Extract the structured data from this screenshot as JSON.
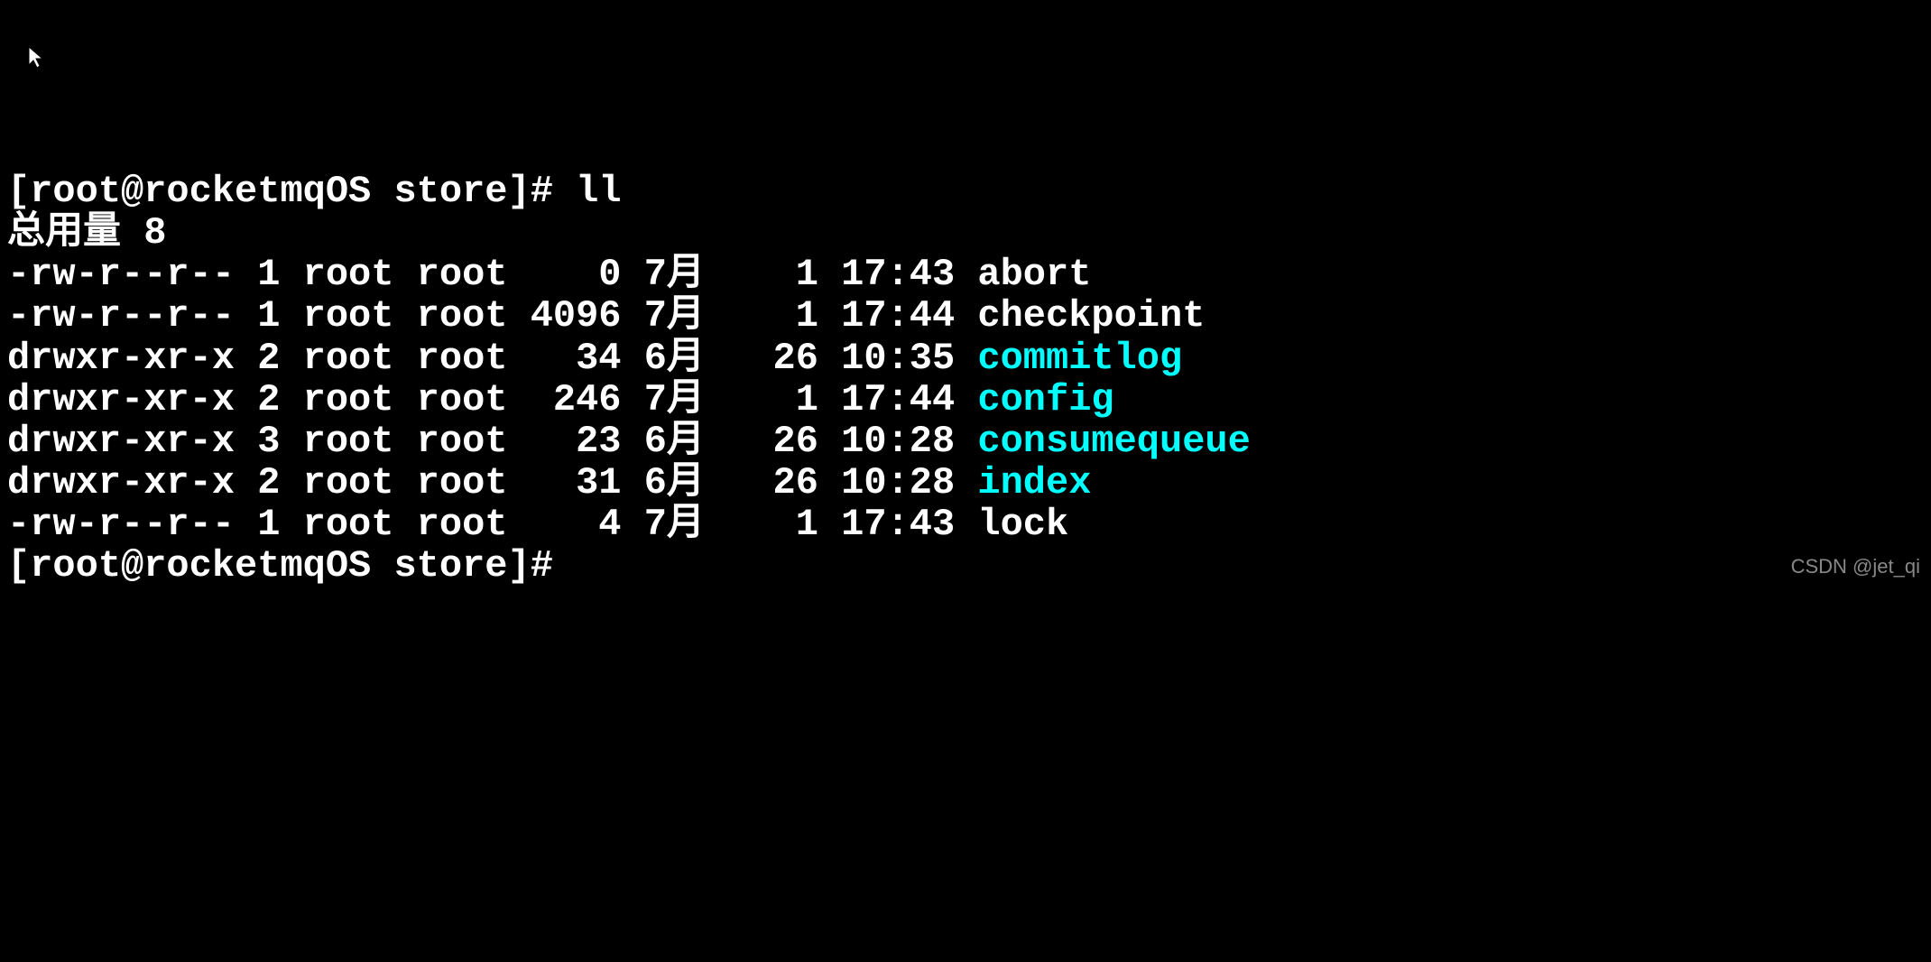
{
  "prompt1": {
    "prefix": "[root@rocketmqOS store]# ",
    "command": "ll"
  },
  "total_label": "总用量 8",
  "files": [
    {
      "perms": "-rw-r--r--",
      "links": "1",
      "owner": "root",
      "group": "root",
      "size": "   0",
      "month": "7月",
      "day": "  1",
      "time": "17:43",
      "name": "abort",
      "is_dir": false
    },
    {
      "perms": "-rw-r--r--",
      "links": "1",
      "owner": "root",
      "group": "root",
      "size": "4096",
      "month": "7月",
      "day": "  1",
      "time": "17:44",
      "name": "checkpoint",
      "is_dir": false
    },
    {
      "perms": "drwxr-xr-x",
      "links": "2",
      "owner": "root",
      "group": "root",
      "size": "  34",
      "month": "6月",
      "day": " 26",
      "time": "10:35",
      "name": "commitlog",
      "is_dir": true
    },
    {
      "perms": "drwxr-xr-x",
      "links": "2",
      "owner": "root",
      "group": "root",
      "size": " 246",
      "month": "7月",
      "day": "  1",
      "time": "17:44",
      "name": "config",
      "is_dir": true
    },
    {
      "perms": "drwxr-xr-x",
      "links": "3",
      "owner": "root",
      "group": "root",
      "size": "  23",
      "month": "6月",
      "day": " 26",
      "time": "10:28",
      "name": "consumequeue",
      "is_dir": true
    },
    {
      "perms": "drwxr-xr-x",
      "links": "2",
      "owner": "root",
      "group": "root",
      "size": "  31",
      "month": "6月",
      "day": " 26",
      "time": "10:28",
      "name": "index",
      "is_dir": true
    },
    {
      "perms": "-rw-r--r--",
      "links": "1",
      "owner": "root",
      "group": "root",
      "size": "   4",
      "month": "7月",
      "day": "  1",
      "time": "17:43",
      "name": "lock",
      "is_dir": false
    }
  ],
  "prompt2": "[root@rocketmqOS store]# ",
  "watermark": "CSDN @jet_qi"
}
